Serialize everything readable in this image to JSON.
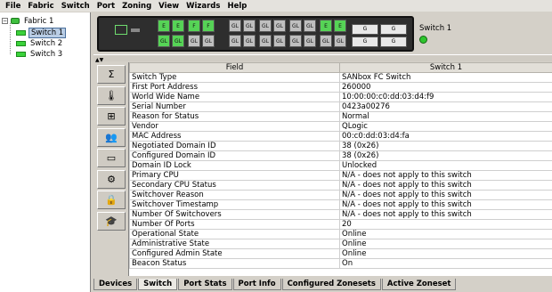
{
  "menu": [
    "File",
    "Fabric",
    "Switch",
    "Port",
    "Zoning",
    "View",
    "Wizards",
    "Help"
  ],
  "tree": {
    "fabric_label": "Fabric 1",
    "switches": [
      "Switch 1",
      "Switch 2",
      "Switch 3"
    ],
    "selected": "Switch 1"
  },
  "faceplate": {
    "switch_label": "Switch 1",
    "port_labels": [
      "E",
      "E",
      "GL",
      "GL",
      "F",
      "F",
      "GL",
      "GL",
      "GL",
      "GL",
      "GL",
      "GL",
      "GL",
      "GL",
      "GL",
      "GL",
      "GL",
      "GL",
      "GL",
      "GL",
      "E",
      "E",
      "GL",
      "GL",
      "G",
      "G",
      "G",
      "G"
    ]
  },
  "sidebar_icons": [
    "sigma-icon",
    "thermometer-icon",
    "network-icon",
    "users-icon",
    "memory-icon",
    "gear-icon",
    "lock-icon",
    "graduation-cap-icon"
  ],
  "table": {
    "headers": [
      "Field",
      "Switch 1"
    ],
    "rows": [
      [
        "Switch Type",
        "SANbox FC Switch"
      ],
      [
        "First Port Address",
        "260000"
      ],
      [
        "World Wide Name",
        "10:00:00:c0:dd:03:d4:f9"
      ],
      [
        "Serial Number",
        "0423a00276"
      ],
      [
        "Reason for Status",
        "Normal"
      ],
      [
        "Vendor",
        "QLogic"
      ],
      [
        "MAC Address",
        "00:c0:dd:03:d4:fa"
      ],
      [
        "Negotiated Domain ID",
        "38 (0x26)"
      ],
      [
        "Configured Domain ID",
        "38 (0x26)"
      ],
      [
        "Domain ID Lock",
        "Unlocked"
      ],
      [
        "Primary CPU",
        "N/A - does not apply to this switch"
      ],
      [
        "Secondary CPU Status",
        "N/A - does not apply to this switch"
      ],
      [
        "Switchover Reason",
        "N/A - does not apply to this switch"
      ],
      [
        "Switchover Timestamp",
        "N/A - does not apply to this switch"
      ],
      [
        "Number Of Switchovers",
        "N/A - does not apply to this switch"
      ],
      [
        "Number Of Ports",
        "20"
      ],
      [
        "Operational State",
        "Online"
      ],
      [
        "Administrative State",
        "Online"
      ],
      [
        "Configured Admin State",
        "Online"
      ],
      [
        "Beacon Status",
        "On"
      ]
    ]
  },
  "tabs": [
    "Devices",
    "Switch",
    "Port Stats",
    "Port Info",
    "Configured Zonesets",
    "Active Zoneset"
  ],
  "active_tab": "Switch"
}
